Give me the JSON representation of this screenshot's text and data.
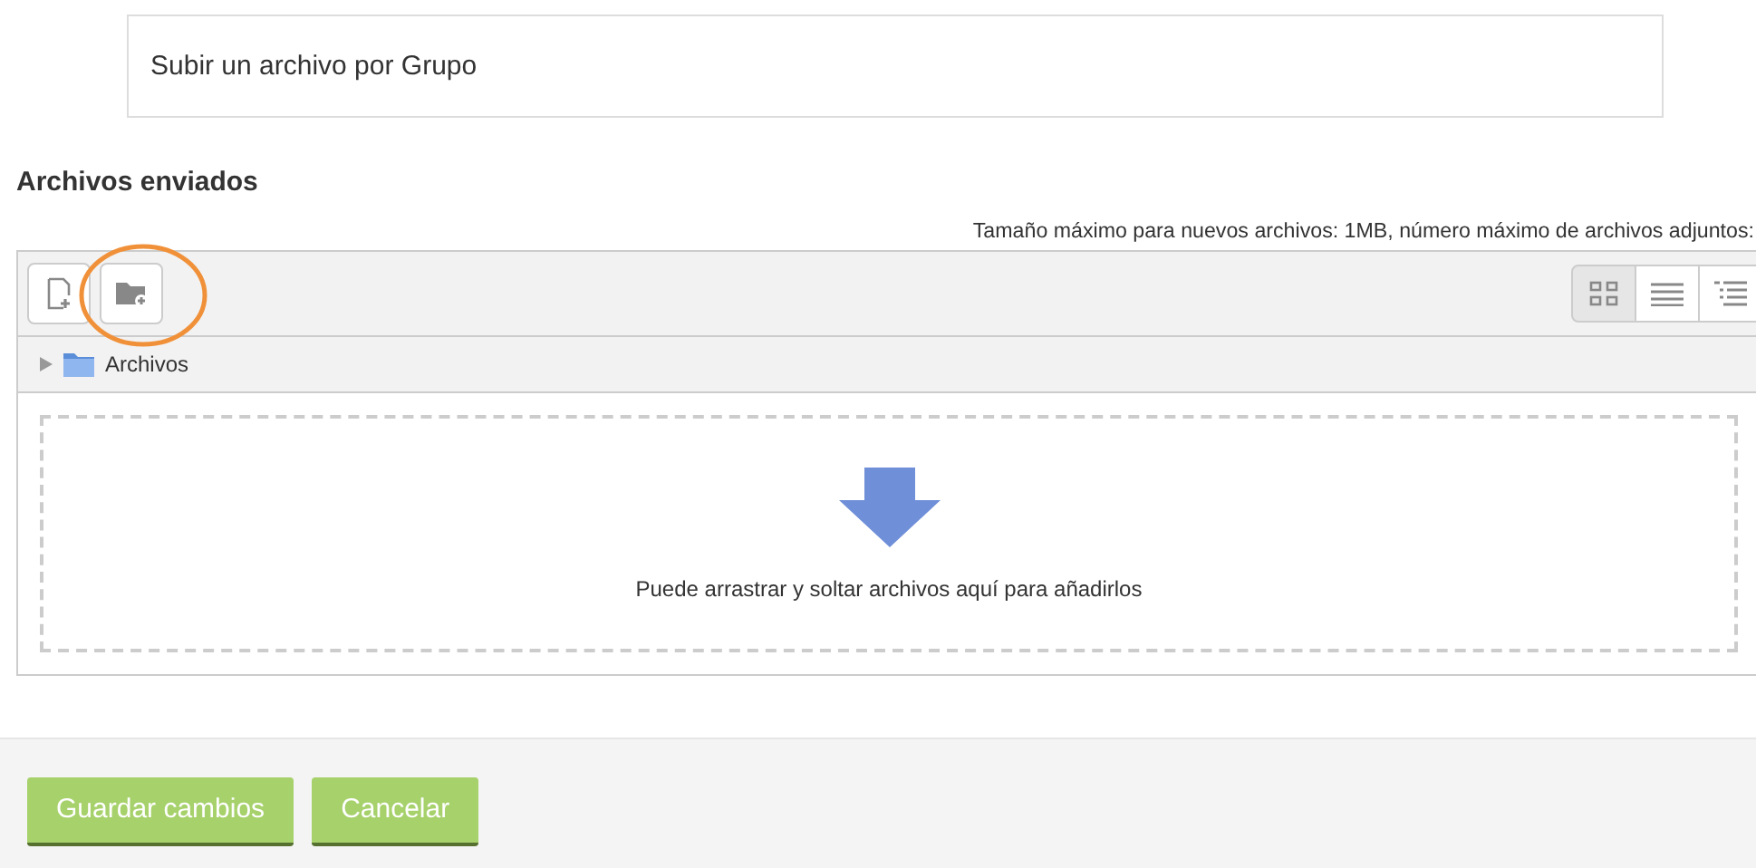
{
  "description": {
    "text": "Subir un archivo por Grupo"
  },
  "section": {
    "title": "Archivos enviados",
    "limits": "Tamaño máximo para nuevos archivos: 1MB, número máximo de archivos adjuntos:"
  },
  "file_manager": {
    "toolbar": [
      {
        "kind": "add-file"
      },
      {
        "kind": "add-folder",
        "highlighted": true
      }
    ],
    "views": [
      {
        "kind": "icons",
        "selected": true
      },
      {
        "kind": "list",
        "selected": false
      },
      {
        "kind": "tree",
        "selected": false
      }
    ],
    "path": "Archivos",
    "dropzone": "Puede arrastrar y soltar archivos aquí para añadirlos"
  },
  "buttons": [
    "Guardar cambios",
    "Cancelar"
  ]
}
